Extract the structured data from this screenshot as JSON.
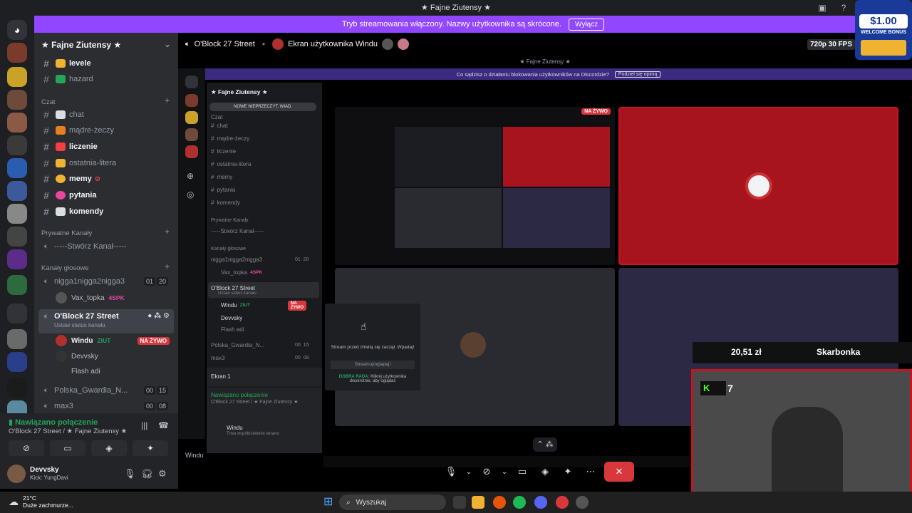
{
  "window": {
    "title": "★ Fajne Ziutensy ★"
  },
  "banner": {
    "text": "Tryb streamowania włączony. Nazwy użytkownika są skrócone.",
    "button": "Wyłącz"
  },
  "rail": {
    "home_badge": "6"
  },
  "sidebar": {
    "guild_name": "★ Fajne Ziutensy ★",
    "top_channels": [
      {
        "label": "levele",
        "color": "#f0b232"
      },
      {
        "label": "hazard",
        "color": "#23a55a"
      }
    ],
    "category_chat": "Czat",
    "chat_channels": [
      {
        "label": "chat",
        "color": "#dbdee1",
        "bright": false
      },
      {
        "label": "mądre-żeczy",
        "color": "#e67e22",
        "bright": false
      },
      {
        "label": "liczenie",
        "color": "#f23f43",
        "bright": true
      },
      {
        "label": "ostatnia-litera",
        "color": "#f0b232",
        "bright": false
      },
      {
        "label": "memy",
        "color": "#f0b232",
        "bright": true
      },
      {
        "label": "pytania",
        "color": "#eb459e",
        "bright": true
      },
      {
        "label": "komendy",
        "color": "#dbdee1",
        "bright": true
      }
    ],
    "category_private": "Prywatne Kanały",
    "private_channel": "-----Stwórz Kanał-----",
    "category_voice": "Kanały głosowe",
    "voice_channels": [
      {
        "label": "nigga1nigga2nigga3",
        "counts": [
          "01",
          "20"
        ]
      },
      {
        "label": "O'Block 27 Street",
        "status": "Ustaw status kanału"
      },
      {
        "label": "Polska_Gwardia_N...",
        "counts": [
          "00",
          "15"
        ]
      },
      {
        "label": "max3",
        "counts": [
          "00",
          "08"
        ]
      }
    ],
    "voice_users_1": [
      {
        "name": "Vax_topka",
        "badge": "4SPK"
      }
    ],
    "voice_users_2": [
      {
        "name": "Windu",
        "badge": "ZIUT",
        "live": "NA ŻYWO"
      },
      {
        "name": "Devvsky"
      },
      {
        "name": "Flash adi"
      }
    ]
  },
  "voice_panel": {
    "status": "Nawiązano połączenie",
    "where": "O'Block 27 Street / ★ Fajne Ziutensy ★"
  },
  "user_panel": {
    "name": "Devvsky",
    "sub": "Kick: YungDavi"
  },
  "header": {
    "channel": "O'Block 27 Street",
    "stream_label": "Ekran użytkownika Windu",
    "quality": "720p 30 FPS"
  },
  "inner": {
    "title": "★ Fajne Ziutensy ★",
    "banner": "Co sądzisz o działaniu blokowania użytkowników na Discordzie?",
    "banner_btn": "Podziel się opinią",
    "guild": "★ Fajne Ziutensy ★",
    "new_btn": "NOWE NIEPRZECZYT. WIAD.",
    "channels": [
      "chat",
      "mądre-żeczy",
      "liczenie",
      "ostatnia-litera",
      "memy",
      "pytania",
      "komendy"
    ],
    "cat_private": "Prywatne Kanały",
    "private_channel": "-----Stwórz Kanał-----",
    "cat_voice": "Kanały głosowe",
    "voice1": "nigga1nigga2nigga3",
    "voice1_counts": "01  20",
    "voice1_user": "Vax_topka",
    "voice1_badge": "4SPK",
    "voice2": "O'Block 27 Street",
    "voice2_status": "Ustaw status kanału",
    "u1": "Windu",
    "u1_badge": "ZIUT",
    "u1_live": "NA ŻYWO",
    "u2": "Devvsky",
    "u3": "Flash adi",
    "voice3": "Polska_Gwardia_N...",
    "voice3_counts": "00  15",
    "voice4": "max3",
    "voice4_counts": "00  08",
    "ekran": "Ekran 1",
    "conn": "Nawiązano połączenie",
    "conn_where": "O'Block 27 Street / ★ Fajne Ziutensy ★",
    "user": "Windu",
    "user_sub": "Trwa współdzielenie ekranu",
    "live_small": "NA ŻYWO",
    "stream_msg": "Stream przed chwilą się zaczął. Wpadaj!",
    "stream_btn": "Streamuj/oglądaj!",
    "tip_label": "DOBRA RADA:",
    "tip": "Kliknij użytkownika dwukrotnie, aby oglądać",
    "bottom_user": "Windu"
  },
  "overlay": {
    "welcome_amount": "$1.00",
    "welcome_text": "WELCOME BONUS",
    "amount": "20,51 zł",
    "skarbonka": "Skarbonka",
    "kick_count": "7"
  },
  "taskbar": {
    "temp": "21°C",
    "weather": "Duże zachmurze...",
    "search": "Wyszukaj"
  },
  "colors": {
    "accent": "#9146ff",
    "online": "#23a55a",
    "live": "#da373c",
    "tile_red": "#a8141e",
    "tile_purple": "#2c2945"
  }
}
